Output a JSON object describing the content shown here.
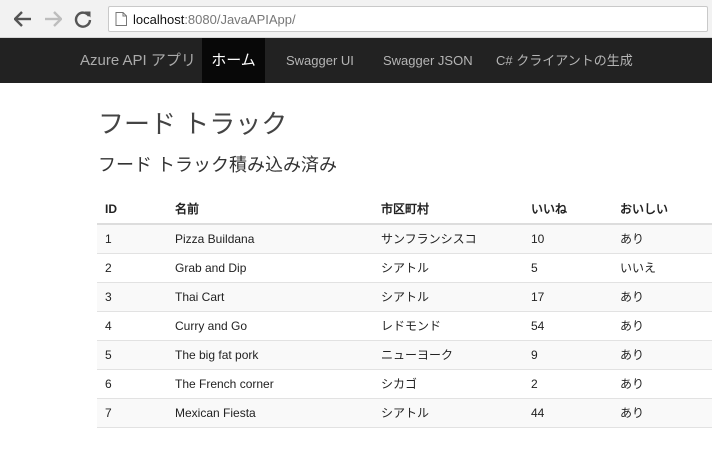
{
  "browser": {
    "url_host": "localhost",
    "url_path": ":8080/JavaAPIApp/"
  },
  "navbar": {
    "brand": "Azure API アプリ",
    "items": [
      {
        "label": "ホーム",
        "active": true
      },
      {
        "label": "Swagger UI",
        "active": false
      },
      {
        "label": "Swagger JSON",
        "active": false
      },
      {
        "label": "C# クライアントの生成",
        "active": false
      }
    ]
  },
  "main": {
    "title": "フード トラック",
    "subtitle": "フード トラック積み込み済み",
    "table": {
      "headers": [
        "ID",
        "名前",
        "市区町村",
        "いいね",
        "おいしい"
      ],
      "rows": [
        [
          "1",
          "Pizza Buildana",
          "サンフランシスコ",
          "10",
          "あり"
        ],
        [
          "2",
          "Grab and Dip",
          "シアトル",
          "5",
          "いいえ"
        ],
        [
          "3",
          "Thai Cart",
          "シアトル",
          "17",
          "あり"
        ],
        [
          "4",
          "Curry and Go",
          "レドモンド",
          "54",
          "あり"
        ],
        [
          "5",
          "The big fat pork",
          "ニューヨーク",
          "9",
          "あり"
        ],
        [
          "6",
          "The French corner",
          "シカゴ",
          "2",
          "あり"
        ],
        [
          "7",
          "Mexican Fiesta",
          "シアトル",
          "44",
          "あり"
        ]
      ]
    }
  },
  "icons": {
    "back": "arrow-left-icon",
    "forward": "arrow-right-icon",
    "reload": "reload-icon",
    "page": "page-icon"
  }
}
